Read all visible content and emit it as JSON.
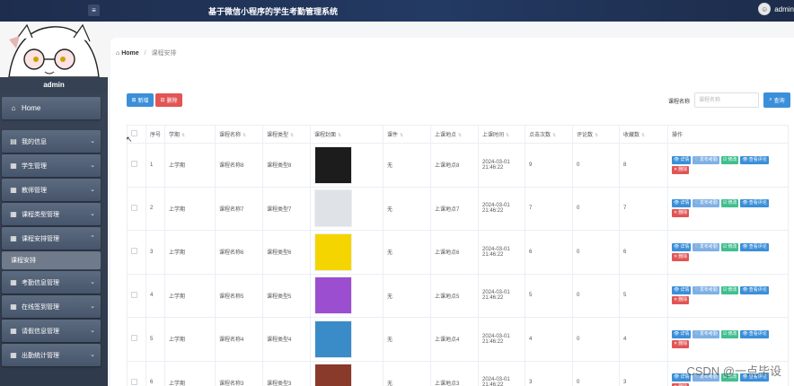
{
  "header": {
    "title": "基于微信小程序的学生考勤管理系统",
    "username": "admin"
  },
  "sidebar": {
    "username": "admin",
    "items": [
      {
        "label": "Home",
        "icon": "home-icon"
      },
      {
        "label": "我的信息",
        "icon": "file-icon"
      },
      {
        "label": "学生管理",
        "icon": "grid-icon"
      },
      {
        "label": "教师管理",
        "icon": "grid-icon"
      },
      {
        "label": "课程类型管理",
        "icon": "grid-icon"
      },
      {
        "label": "课程安排管理",
        "icon": "grid-icon"
      },
      {
        "label": "考勤信息管理",
        "icon": "grid-icon"
      },
      {
        "label": "在线签到管理",
        "icon": "grid-icon"
      },
      {
        "label": "请假信息管理",
        "icon": "grid-icon"
      },
      {
        "label": "出勤统计管理",
        "icon": "grid-icon"
      }
    ],
    "active_sub": "课程安排"
  },
  "breadcrumb": {
    "home": "Home",
    "current": "课程安排"
  },
  "toolbar": {
    "add_label": "新增",
    "delete_label": "删除"
  },
  "search": {
    "label": "课程名称",
    "placeholder": "课程名称",
    "button_label": "查询"
  },
  "table": {
    "headers": [
      "序号",
      "学期",
      "课程名称",
      "课程类型",
      "课程封面",
      "课件",
      "上课地点",
      "上课时间",
      "点击次数",
      "评论数",
      "收藏数",
      "操作"
    ],
    "rows": [
      {
        "index": "1",
        "term": "上学期",
        "name": "课程名称8",
        "type": "课程类型8",
        "courseware": "无",
        "location": "上课地点8",
        "time": "2024-03-01 21:46:22",
        "clicks": "9",
        "comments": "0",
        "favorites": "8",
        "cover_color": "#1c1c1c"
      },
      {
        "index": "2",
        "term": "上学期",
        "name": "课程名称7",
        "type": "课程类型7",
        "courseware": "无",
        "location": "上课地点7",
        "time": "2024-03-01 21:46:22",
        "clicks": "7",
        "comments": "0",
        "favorites": "7",
        "cover_color": "#dfe3e8"
      },
      {
        "index": "3",
        "term": "上学期",
        "name": "课程名称6",
        "type": "课程类型6",
        "courseware": "无",
        "location": "上课地点6",
        "time": "2024-03-01 21:46:22",
        "clicks": "6",
        "comments": "0",
        "favorites": "6",
        "cover_color": "#f5d500"
      },
      {
        "index": "4",
        "term": "上学期",
        "name": "课程名称5",
        "type": "课程类型5",
        "courseware": "无",
        "location": "上课地点5",
        "time": "2024-03-01 21:46:22",
        "clicks": "5",
        "comments": "0",
        "favorites": "5",
        "cover_color": "#9b4fd0"
      },
      {
        "index": "5",
        "term": "上学期",
        "name": "课程名称4",
        "type": "课程类型4",
        "courseware": "无",
        "location": "上课地点4",
        "time": "2024-03-01 21:46:22",
        "clicks": "4",
        "comments": "0",
        "favorites": "4",
        "cover_color": "#3a8cc9"
      },
      {
        "index": "6",
        "term": "上学期",
        "name": "课程名称3",
        "type": "课程类型3",
        "courseware": "无",
        "location": "上课地点3",
        "time": "2024-03-01 21:46:22",
        "clicks": "3",
        "comments": "0",
        "favorites": "3",
        "cover_color": "#8a3a2a"
      }
    ],
    "actions": [
      {
        "label": "详情",
        "icon": "eye-icon",
        "style": "blue"
      },
      {
        "label": "发布考勤",
        "icon": "heart-icon",
        "style": "light"
      },
      {
        "label": "修改",
        "icon": "edit-icon",
        "style": "green"
      },
      {
        "label": "查看评论",
        "icon": "eye-icon",
        "style": "blue"
      },
      {
        "label": "删除",
        "icon": "close-icon",
        "style": "red"
      }
    ]
  },
  "watermark": "CSDN @一点毕设"
}
